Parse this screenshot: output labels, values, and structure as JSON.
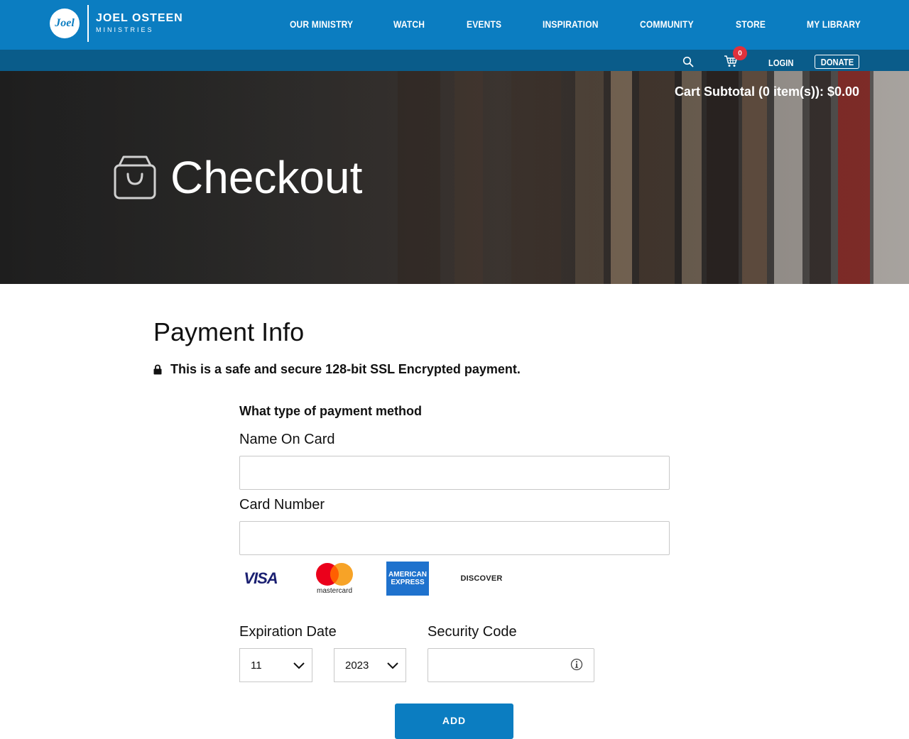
{
  "brand": {
    "logo_script": "Joel",
    "logo_main": "JOEL OSTEEN",
    "logo_sub": "MINISTRIES",
    "primary_color": "#0b7dc1",
    "secondary_color": "#0a5c8a"
  },
  "nav": {
    "items": [
      "OUR MINISTRY",
      "WATCH",
      "EVENTS",
      "INSPIRATION",
      "COMMUNITY",
      "STORE",
      "MY LIBRARY"
    ]
  },
  "utility": {
    "search_icon": "search-icon",
    "cart_icon": "cart-icon",
    "cart_count": "0",
    "login": "LOGIN",
    "donate": "DONATE"
  },
  "hero": {
    "cart_subtotal": "Cart Subtotal (0 item(s)): $0.00",
    "title": "Checkout",
    "icon": "shopping-bag-icon"
  },
  "payment": {
    "title": "Payment Info",
    "secure_note": "This is a safe and secure 128-bit SSL Encrypted payment.",
    "method_label": "What type of payment method",
    "name_label": "Name On Card",
    "name_value": "",
    "card_label": "Card Number",
    "card_value": "",
    "cards": {
      "visa": "VISA",
      "mastercard": "mastercard",
      "amex_line1": "AMERICAN",
      "amex_line2": "EXPRESS",
      "discover": "DISCOVER"
    },
    "expiration_label": "Expiration Date",
    "exp_month": "11",
    "exp_year": "2023",
    "security_label": "Security Code",
    "security_value": "",
    "add_button": "ADD"
  }
}
